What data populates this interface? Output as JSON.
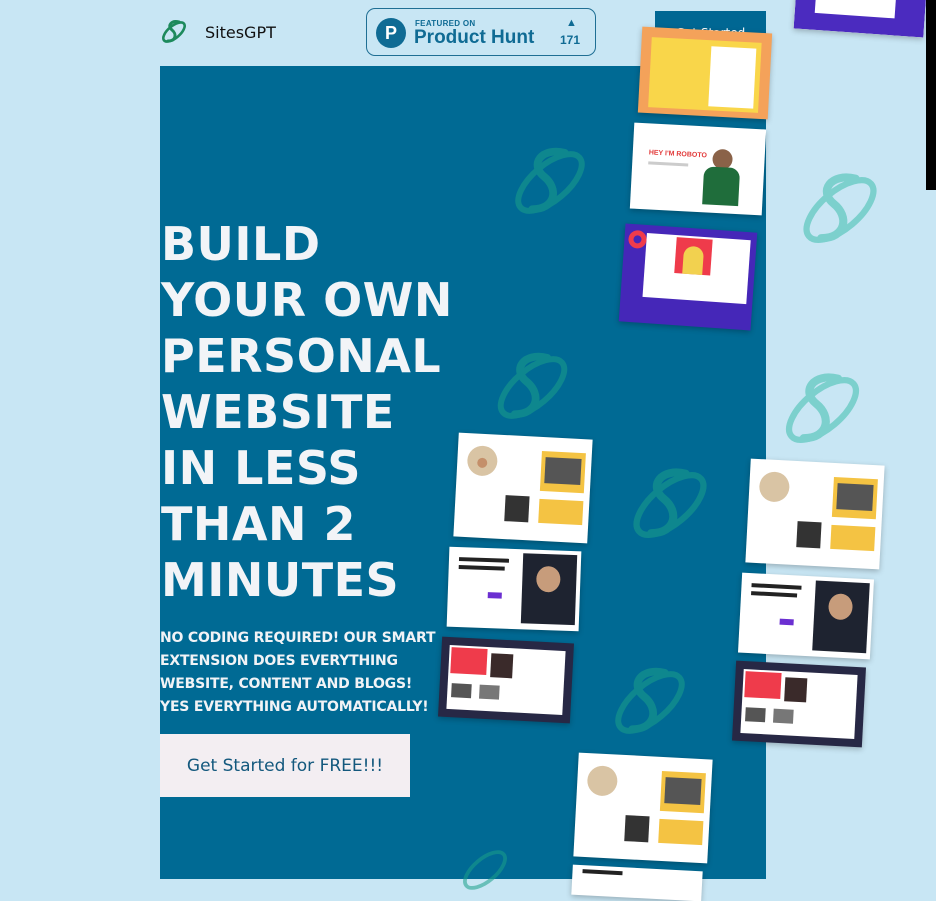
{
  "brand": {
    "name": "SitesGPT",
    "accent": "#0f6b94",
    "hero_bg": "#006a94",
    "page_bg": "#c8e6f4"
  },
  "badge": {
    "featured": "FEATURED ON",
    "name": "Product Hunt",
    "letter": "P",
    "arrow": "▲",
    "count": "171"
  },
  "nav": {
    "cta_label": "Get Started"
  },
  "hero": {
    "headline": "BUILD\nYOUR OWN\nPERSONAL\nWEBSITE\nIN LESS\nTHAN 2\nMINUTES",
    "subtext": "NO CODING REQUIRED! OUR SMART EXTENSION DOES EVERYTHING WEBSITE, CONTENT AND BLOGS! YES EVERYTHING AUTOMATICALLY!",
    "cta_label": "Get Started for FREE!!!"
  },
  "thumbnails": {
    "robot_text": "HEY I'M ROBOTO"
  }
}
